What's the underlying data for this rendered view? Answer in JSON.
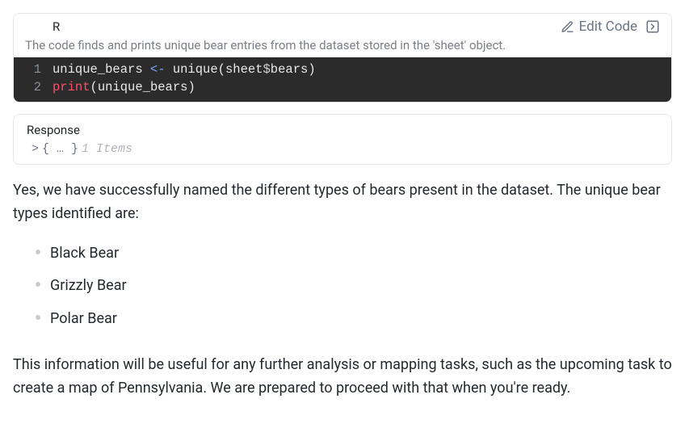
{
  "code_block": {
    "language": "R",
    "edit_label": "Edit Code",
    "description": "The code finds and prints unique bear entries from the dataset stored in the 'sheet' object.",
    "lines": [
      {
        "num": "1",
        "segments": [
          {
            "cls": "tok-ident",
            "t": "unique_bears "
          },
          {
            "cls": "tok-op",
            "t": "<-"
          },
          {
            "cls": "tok-ident",
            "t": " unique"
          },
          {
            "cls": "tok-paren",
            "t": "("
          },
          {
            "cls": "tok-ident",
            "t": "sheet"
          },
          {
            "cls": "tok-dollar",
            "t": "$"
          },
          {
            "cls": "tok-ident",
            "t": "bears"
          },
          {
            "cls": "tok-paren",
            "t": ")"
          }
        ]
      },
      {
        "num": "2",
        "segments": [
          {
            "cls": "tok-key",
            "t": "print"
          },
          {
            "cls": "tok-paren",
            "t": "("
          },
          {
            "cls": "tok-ident",
            "t": "unique_bears"
          },
          {
            "cls": "tok-paren",
            "t": ")"
          }
        ]
      }
    ]
  },
  "response": {
    "title": "Response",
    "chevron": ">",
    "braces": "{ … }",
    "items_text": "1 Items"
  },
  "message": {
    "intro": "Yes, we have successfully named the different types of bears present in the dataset. The unique bear types identified are:",
    "bears": [
      "Black Bear",
      "Grizzly Bear",
      "Polar Bear"
    ],
    "outro": "This information will be useful for any further analysis or mapping tasks, such as the upcoming task to create a map of Pennsylvania. We are prepared to proceed with that when you're ready."
  }
}
